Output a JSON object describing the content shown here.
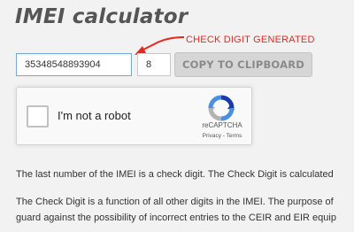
{
  "page": {
    "title": "IMEI calculator",
    "annotation": "CHECK DIGIT GENERATED"
  },
  "form": {
    "imei_value": "35348548893904",
    "check_digit_value": "8",
    "copy_button_label": "COPY TO CLIPBOARD"
  },
  "recaptcha": {
    "label": "I'm not a robot",
    "brand": "reCAPTCHA",
    "privacy_link": "Privacy",
    "separator": " - ",
    "terms_link": "Terms"
  },
  "content": {
    "paragraph1_line1": "The last number of the IMEI is a check digit. The Check Digit is calculated",
    "paragraph2_line1": "The Check Digit is a function of all other digits in the IMEI. The purpose of",
    "paragraph2_line2": "guard against the possibility of incorrect entries to the CEIR and EIR equip"
  },
  "colors": {
    "accent": "#e8271f",
    "input_border": "#7aa7d6",
    "background": "#f2f2f2"
  },
  "icons": {
    "arrow": "red-arrow-icon",
    "recaptcha_logo": "recaptcha-logo-icon"
  }
}
